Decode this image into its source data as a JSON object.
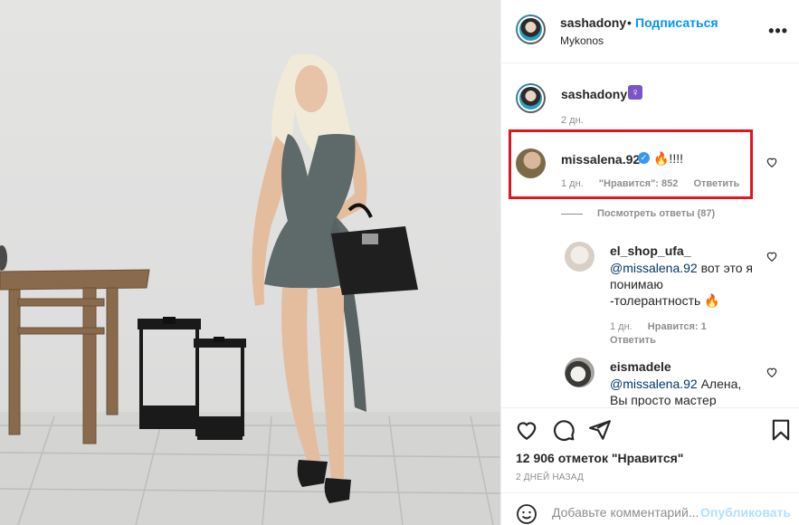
{
  "post": {
    "author": "sashadony",
    "dot": "•",
    "follow_label": "Подписаться",
    "location": "Mykonos",
    "more_label": "•••"
  },
  "caption": {
    "author": "sashadony",
    "emoji": "♀",
    "time": "2 дн."
  },
  "comments": [
    {
      "author": "missalena.92",
      "text": "🔥!!!!",
      "time": "1 дн.",
      "likes": "\"Нравится\": 852",
      "reply": "Ответить",
      "view_replies": "Посмотреть ответы (87)"
    },
    {
      "author": "el_shop_ufa_",
      "mention": "@missalena.92",
      "text_1": " вот это я",
      "text_2": "понимаю",
      "text_3": "-толерантность 🔥",
      "time": "1 дн.",
      "likes": "Нравится: 1",
      "reply": "Ответить"
    },
    {
      "author": "eismadele",
      "mention": "@missalena.92",
      "text_1": " Алена,",
      "text_2": "Вы просто мастер"
    }
  ],
  "footer": {
    "likes": "12 906 отметок \"Нравится\"",
    "date": "2 ДНЕЙ НАЗАД",
    "comment_placeholder": "Добавьте комментарий...",
    "publish_label": "Опубликовать"
  },
  "colors": {
    "link": "#0095f6",
    "highlight_box": "#e4141f",
    "verified": "#3897f0"
  }
}
